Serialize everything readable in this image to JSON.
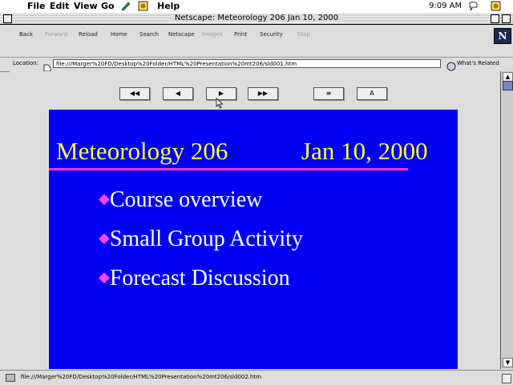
{
  "menu_bar": {
    "items": [
      "File",
      "Edit",
      "View",
      "Go",
      "Help"
    ],
    "clock": "9:09 AM"
  },
  "window": {
    "title": "Netscape: Meteorology 206 Jan 10, 2000"
  },
  "toolbar": {
    "back": "Back",
    "forward": "Forward",
    "reload": "Reload",
    "home": "Home",
    "search": "Search",
    "netscape": "Netscape",
    "images": "Images",
    "print": "Print",
    "security": "Security",
    "stop": "Stop",
    "logo": "N"
  },
  "location": {
    "label": "Location:",
    "url": "file:///Marger%20FD/Desktop%20Folder/HTML%20Presentation%20mt206/sld001.htm",
    "related": "What's Related"
  },
  "slide_nav": {
    "first": "◀◀",
    "prev": "◀",
    "next": "▶",
    "last": "▶▶",
    "outline": "≡",
    "text": "A"
  },
  "slide": {
    "title_left": "Meteorology 206",
    "title_right": "Jan 10, 2000",
    "bullets": [
      "Course overview",
      "Small Group Activity",
      "Forecast Discussion"
    ]
  },
  "status": {
    "text": "file:///Marger%20FD/Desktop%20Folder/HTML%20Presentation%20mt206/sld002.htm"
  }
}
